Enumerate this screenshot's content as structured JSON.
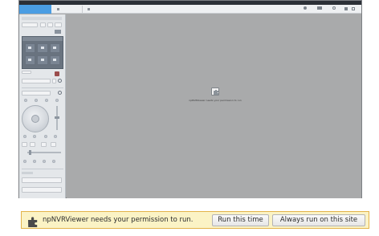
{
  "app": {
    "active_tab_label": "",
    "tabs": [
      "",
      ""
    ],
    "toolbar_labels": [
      "",
      "",
      "",
      ""
    ]
  },
  "center": {
    "icon": "puzzle-plugin-icon",
    "message": "npNVRViewer needs your permission to run"
  },
  "notification": {
    "icon": "puzzle-plugin-icon",
    "message": "npNVRViewer needs your permission to run.",
    "run_button": "Run this time",
    "always_button": "Always run on this site"
  },
  "colors": {
    "accent": "#4a9de3",
    "title_bar": "#2b2f36",
    "sidebar": "#e4e7ea",
    "viewport": "#a9aaab",
    "notification_border": "#e3b34a"
  }
}
